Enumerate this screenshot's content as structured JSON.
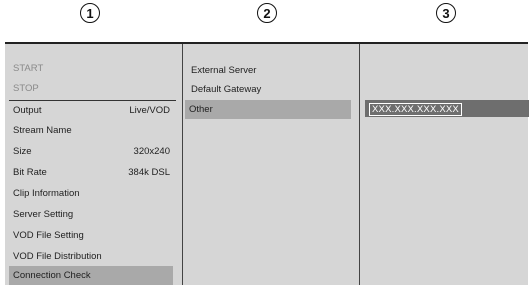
{
  "callouts": [
    "1",
    "2",
    "3"
  ],
  "panel1": {
    "items": [
      {
        "label": "START",
        "value": "",
        "state": "disabled"
      },
      {
        "label": "STOP",
        "value": "",
        "state": "disabled"
      },
      {
        "label": "Output",
        "value": "Live/VOD",
        "state": "normal"
      },
      {
        "label": "Stream Name",
        "value": "",
        "state": "normal"
      },
      {
        "label": "Size",
        "value": "320x240",
        "state": "normal"
      },
      {
        "label": "Bit Rate",
        "value": "384k DSL",
        "state": "normal"
      },
      {
        "label": "Clip Information",
        "value": "",
        "state": "normal"
      },
      {
        "label": "Server Setting",
        "value": "",
        "state": "normal"
      },
      {
        "label": "VOD File Setting",
        "value": "",
        "state": "normal"
      },
      {
        "label": "VOD File Distribution",
        "value": "",
        "state": "normal"
      },
      {
        "label": "Connection Check",
        "value": "",
        "state": "selected"
      }
    ]
  },
  "panel2": {
    "items": [
      {
        "label": "External Server",
        "state": "normal"
      },
      {
        "label": "Default Gateway",
        "state": "normal"
      },
      {
        "label": "Other",
        "state": "selected"
      }
    ]
  },
  "panel3": {
    "address_value": "XXX.XXX.XXX.XXX"
  },
  "colors": {
    "background": "#d6d6d6",
    "selected_row": "#a9a9a9",
    "address_bar": "#6e6e6e",
    "disabled_text": "#8a8a8a"
  }
}
